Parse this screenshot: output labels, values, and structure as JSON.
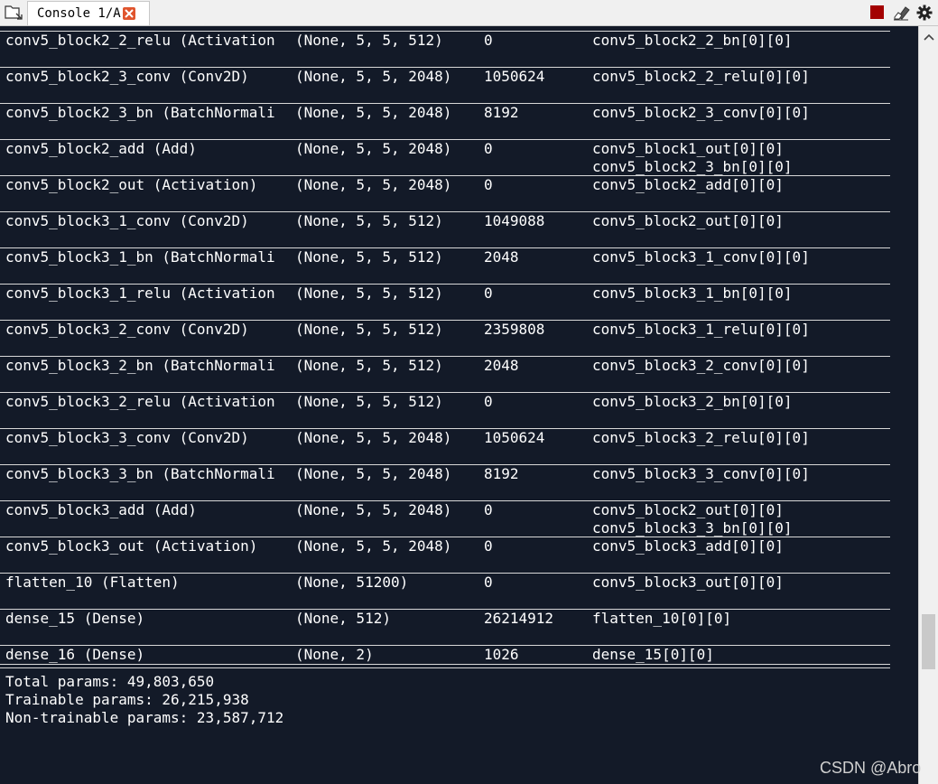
{
  "tab": {
    "label": "Console 1/A"
  },
  "toolbar": {
    "icons": [
      "folder-icon",
      "stop-icon",
      "eraser-icon",
      "gear-icon"
    ],
    "colors": {
      "stop": "#a30000",
      "close": "#e0552e"
    }
  },
  "console": {
    "background": "#131a28",
    "rows": [
      [
        "conv5_block2_2_relu (Activation",
        "(None, 5, 5, 512)",
        "0",
        "conv5_block2_2_bn[0][0]"
      ],
      [
        "conv5_block2_3_conv (Conv2D)",
        "(None, 5, 5, 2048)",
        "1050624",
        "conv5_block2_2_relu[0][0]"
      ],
      [
        "conv5_block2_3_bn (BatchNormali",
        "(None, 5, 5, 2048)",
        "8192",
        "conv5_block2_3_conv[0][0]"
      ],
      [
        "conv5_block2_add (Add)",
        "(None, 5, 5, 2048)",
        "0",
        "conv5_block1_out[0][0]",
        "conv5_block2_3_bn[0][0]"
      ],
      [
        "conv5_block2_out (Activation)",
        "(None, 5, 5, 2048)",
        "0",
        "conv5_block2_add[0][0]"
      ],
      [
        "conv5_block3_1_conv (Conv2D)",
        "(None, 5, 5, 512)",
        "1049088",
        "conv5_block2_out[0][0]"
      ],
      [
        "conv5_block3_1_bn (BatchNormali",
        "(None, 5, 5, 512)",
        "2048",
        "conv5_block3_1_conv[0][0]"
      ],
      [
        "conv5_block3_1_relu (Activation",
        "(None, 5, 5, 512)",
        "0",
        "conv5_block3_1_bn[0][0]"
      ],
      [
        "conv5_block3_2_conv (Conv2D)",
        "(None, 5, 5, 512)",
        "2359808",
        "conv5_block3_1_relu[0][0]"
      ],
      [
        "conv5_block3_2_bn (BatchNormali",
        "(None, 5, 5, 512)",
        "2048",
        "conv5_block3_2_conv[0][0]"
      ],
      [
        "conv5_block3_2_relu (Activation",
        "(None, 5, 5, 512)",
        "0",
        "conv5_block3_2_bn[0][0]"
      ],
      [
        "conv5_block3_3_conv (Conv2D)",
        "(None, 5, 5, 2048)",
        "1050624",
        "conv5_block3_2_relu[0][0]"
      ],
      [
        "conv5_block3_3_bn (BatchNormali",
        "(None, 5, 5, 2048)",
        "8192",
        "conv5_block3_3_conv[0][0]"
      ],
      [
        "conv5_block3_add (Add)",
        "(None, 5, 5, 2048)",
        "0",
        "conv5_block2_out[0][0]",
        "conv5_block3_3_bn[0][0]"
      ],
      [
        "conv5_block3_out (Activation)",
        "(None, 5, 5, 2048)",
        "0",
        "conv5_block3_add[0][0]"
      ],
      [
        "flatten_10 (Flatten)",
        "(None, 51200)",
        "0",
        "conv5_block3_out[0][0]"
      ],
      [
        "dense_15 (Dense)",
        "(None, 512)",
        "26214912",
        "flatten_10[0][0]"
      ],
      [
        "dense_16 (Dense)",
        "(None, 2)",
        "1026",
        "dense_15[0][0]"
      ]
    ],
    "summary": [
      "Total params: 49,803,650",
      "Trainable params: 26,215,938",
      "Non-trainable params: 23,587,712"
    ]
  },
  "watermark": "CSDN @Abro"
}
